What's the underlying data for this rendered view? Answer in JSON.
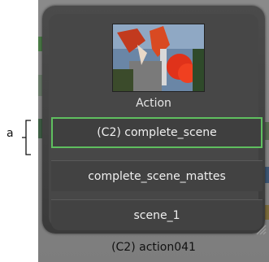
{
  "node": {
    "thumbnail_icon": "scene-thumbnail-image",
    "label": "Action",
    "items": [
      {
        "label": "(C2) complete_scene",
        "selected": true
      },
      {
        "label": "complete_scene_mattes",
        "selected": false
      },
      {
        "label": "scene_1",
        "selected": false
      }
    ],
    "resize_icon": "resize-grip-icon"
  },
  "caption": "(C2) action041",
  "callout": {
    "label": "a"
  },
  "colors": {
    "selection_border": "#5fbf5f",
    "node_background": "#474747",
    "canvas_background": "#8a8a8a"
  }
}
